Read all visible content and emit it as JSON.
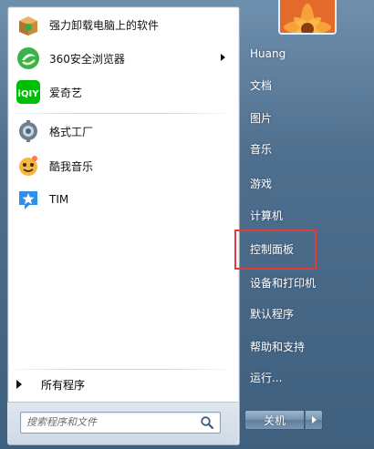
{
  "programs": [
    {
      "label": "强力卸载电脑上的软件",
      "icon": "uninstaller-box-icon",
      "has_submenu": false
    },
    {
      "label": "360安全浏览器",
      "icon": "360-browser-icon",
      "has_submenu": true
    },
    {
      "label": "爱奇艺",
      "icon": "iqiyi-icon",
      "has_submenu": false
    },
    {
      "label": "格式工厂",
      "icon": "format-factory-icon",
      "has_submenu": false
    },
    {
      "label": "酷我音乐",
      "icon": "kuwo-music-icon",
      "has_submenu": false
    },
    {
      "label": "TIM",
      "icon": "tim-icon",
      "has_submenu": false
    }
  ],
  "all_programs_label": "所有程序",
  "search": {
    "placeholder": "搜索程序和文件"
  },
  "right_pane": {
    "user": "Huang",
    "items": [
      "文档",
      "图片",
      "音乐",
      "游戏",
      "计算机",
      "控制面板",
      "设备和打印机",
      "默认程序",
      "帮助和支持",
      "运行..."
    ],
    "highlighted": "控制面板"
  },
  "shutdown_label": "关机",
  "colors": {
    "highlight_border": "#e23b3b",
    "frame": "#4f6f8e",
    "accent_green": "#34a853"
  }
}
